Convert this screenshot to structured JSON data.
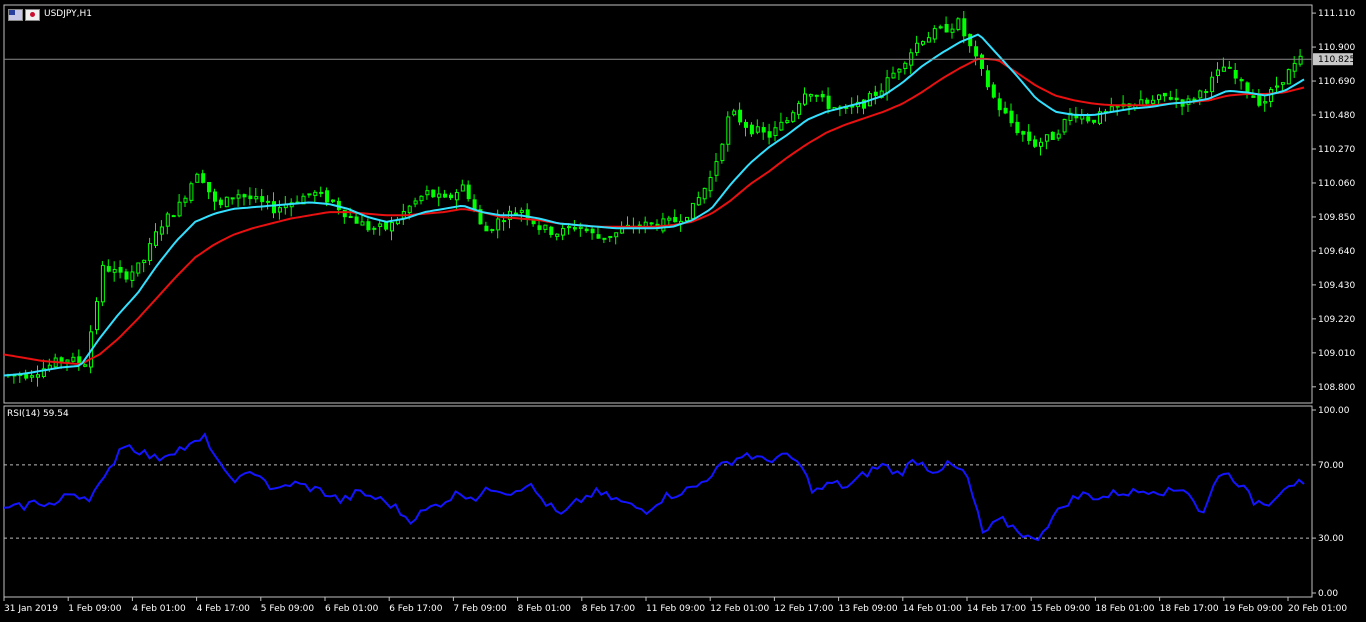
{
  "window": {
    "symbol_label": "USDJPY,H1",
    "icons": [
      "us-flag-icon",
      "jp-flag-icon"
    ]
  },
  "colors": {
    "background": "#000000",
    "axis": "#c0c0c0",
    "candle": "#00ff00",
    "ma_fast": "#33e0ff",
    "ma_slow": "#e81010",
    "rsi": "#1414ff",
    "bid_line": "#8a8a8a",
    "price_tag_bg": "#c8c8c8",
    "price_tag_text": "#000000"
  },
  "chart_data": [
    {
      "type": "candlestick",
      "name": "price",
      "ylim": [
        108.7,
        111.16
      ],
      "y_ticks": [
        "111.110",
        "110.900",
        "110.690",
        "110.480",
        "110.270",
        "110.060",
        "109.850",
        "109.640",
        "109.430",
        "109.220",
        "109.010",
        "108.800"
      ],
      "current_price": "110.825",
      "x_ticks": [
        "31 Jan 2019",
        "1 Feb 09:00",
        "4 Feb 01:00",
        "4 Feb 17:00",
        "5 Feb 09:00",
        "6 Feb 01:00",
        "6 Feb 17:00",
        "7 Feb 09:00",
        "8 Feb 01:00",
        "8 Feb 17:00",
        "11 Feb 09:00",
        "12 Feb 01:00",
        "12 Feb 17:00",
        "13 Feb 09:00",
        "14 Feb 01:00",
        "14 Feb 17:00",
        "15 Feb 09:00",
        "18 Feb 01:00",
        "18 Feb 17:00",
        "19 Feb 09:00",
        "20 Feb 01:00"
      ],
      "close_anchors": [
        108.87,
        108.88,
        108.92,
        108.98,
        108.93,
        109.55,
        109.48,
        109.55,
        109.8,
        109.92,
        110.15,
        109.9,
        110.0,
        109.95,
        109.9,
        109.95,
        110.0,
        109.95,
        109.85,
        109.78,
        109.78,
        109.9,
        110.0,
        109.95,
        110.05,
        109.75,
        109.85,
        109.9,
        109.78,
        109.75,
        109.8,
        109.72,
        109.75,
        109.8,
        109.8,
        109.82,
        109.9,
        110.1,
        110.5,
        110.4,
        110.35,
        110.45,
        110.65,
        110.55,
        110.5,
        110.55,
        110.65,
        110.8,
        110.95,
        111.0,
        111.05,
        110.8,
        110.55,
        110.4,
        110.3,
        110.35,
        110.5,
        110.45,
        110.5,
        110.55,
        110.55,
        110.6,
        110.55,
        110.65,
        110.78,
        110.65,
        110.55,
        110.7,
        110.82
      ],
      "ma_fast_anchors": [
        108.87,
        108.88,
        108.9,
        108.92,
        108.93,
        109.1,
        109.25,
        109.38,
        109.55,
        109.7,
        109.82,
        109.87,
        109.9,
        109.91,
        109.92,
        109.93,
        109.94,
        109.93,
        109.9,
        109.85,
        109.82,
        109.84,
        109.88,
        109.9,
        109.92,
        109.88,
        109.86,
        109.86,
        109.84,
        109.81,
        109.8,
        109.79,
        109.78,
        109.78,
        109.78,
        109.79,
        109.83,
        109.9,
        110.05,
        110.18,
        110.28,
        110.36,
        110.45,
        110.5,
        110.53,
        110.56,
        110.6,
        110.68,
        110.78,
        110.86,
        110.93,
        110.98,
        110.85,
        110.72,
        110.58,
        110.5,
        110.48,
        110.48,
        110.5,
        110.52,
        110.53,
        110.55,
        110.56,
        110.58,
        110.63,
        110.62,
        110.6,
        110.63,
        110.7
      ],
      "ma_slow_anchors": [
        109.0,
        108.98,
        108.96,
        108.95,
        108.94,
        109.0,
        109.1,
        109.22,
        109.35,
        109.48,
        109.6,
        109.68,
        109.74,
        109.78,
        109.81,
        109.84,
        109.86,
        109.88,
        109.88,
        109.87,
        109.86,
        109.86,
        109.87,
        109.88,
        109.9,
        109.88,
        109.85,
        109.84,
        109.83,
        109.81,
        109.8,
        109.79,
        109.79,
        109.79,
        109.79,
        109.8,
        109.82,
        109.87,
        109.95,
        110.05,
        110.13,
        110.22,
        110.3,
        110.37,
        110.42,
        110.46,
        110.5,
        110.55,
        110.62,
        110.7,
        110.77,
        110.83,
        110.82,
        110.74,
        110.66,
        110.6,
        110.57,
        110.55,
        110.54,
        110.54,
        110.54,
        110.55,
        110.56,
        110.57,
        110.6,
        110.61,
        110.61,
        110.62,
        110.65
      ]
    },
    {
      "type": "line",
      "name": "RSI",
      "label": "RSI(14) 59.54",
      "ylim": [
        0,
        100
      ],
      "y_ticks": [
        "100.00",
        "70.00",
        "30.00",
        "0.00"
      ],
      "levels": [
        70,
        30
      ],
      "anchors": [
        45,
        47,
        50,
        48,
        55,
        52,
        62,
        82,
        78,
        73,
        78,
        80,
        85,
        65,
        62,
        67,
        55,
        60,
        58,
        55,
        50,
        55,
        52,
        48,
        40,
        45,
        50,
        55,
        52,
        58,
        55,
        60,
        50,
        42,
        50,
        55,
        52,
        48,
        45,
        52,
        55,
        58,
        66,
        72,
        76,
        72,
        75,
        72,
        55,
        60,
        58,
        65,
        70,
        65,
        73,
        67,
        70,
        65,
        32,
        40,
        35,
        28,
        40,
        50,
        54,
        52,
        55,
        55,
        57,
        55,
        58,
        42,
        67,
        62,
        50,
        50,
        60,
        59.54
      ]
    }
  ]
}
